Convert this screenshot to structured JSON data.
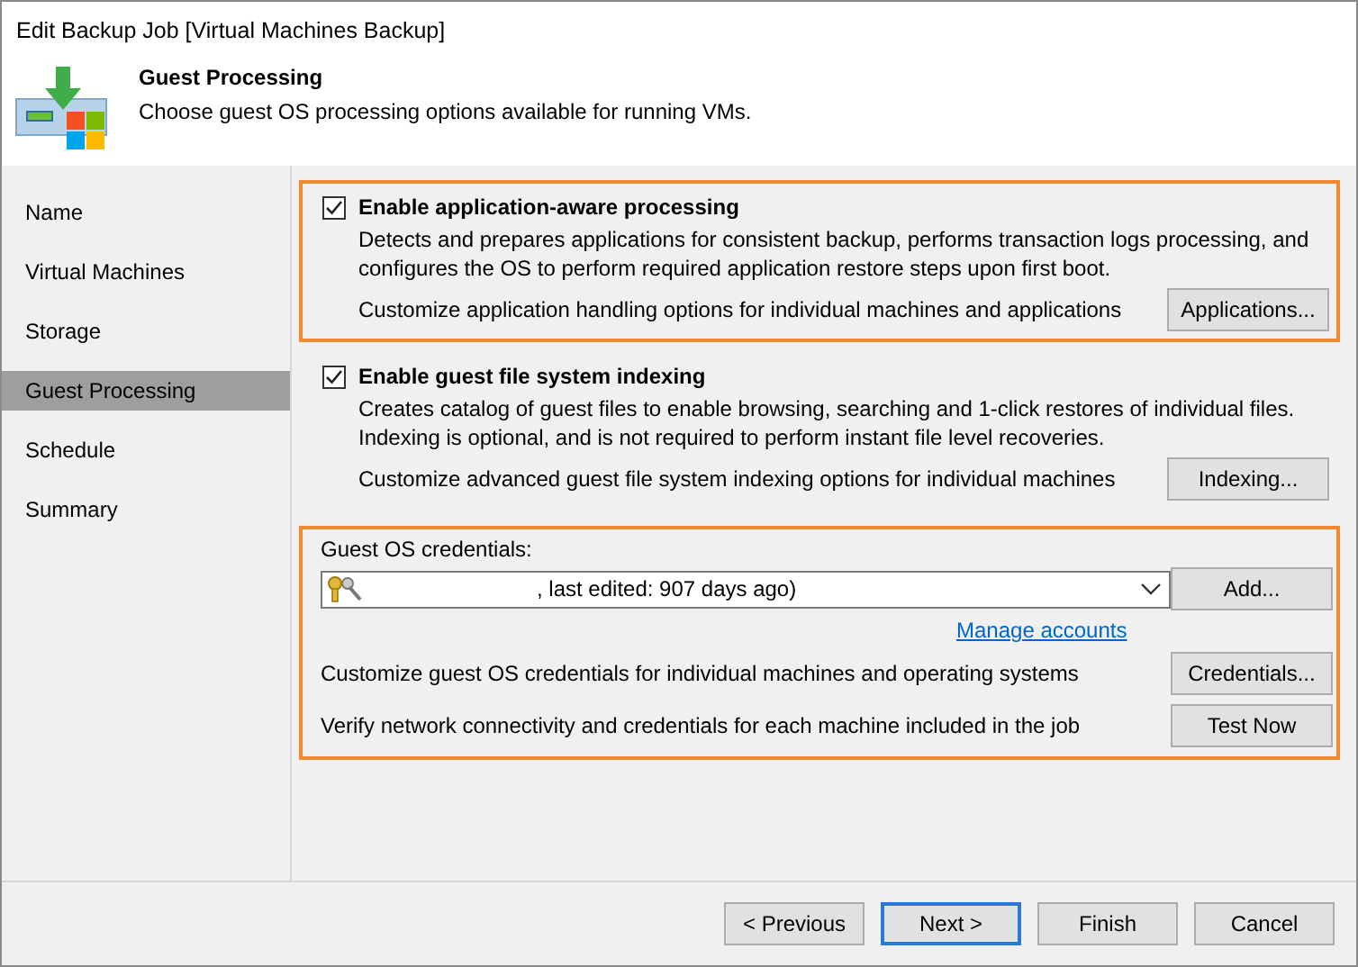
{
  "window": {
    "title": "Edit Backup Job [Virtual Machines Backup]"
  },
  "header": {
    "title": "Guest Processing",
    "subtitle": "Choose guest OS processing options available for running VMs."
  },
  "sidebar": {
    "items": [
      {
        "label": "Name",
        "selected": false
      },
      {
        "label": "Virtual Machines",
        "selected": false
      },
      {
        "label": "Storage",
        "selected": false
      },
      {
        "label": "Guest Processing",
        "selected": true
      },
      {
        "label": "Schedule",
        "selected": false
      },
      {
        "label": "Summary",
        "selected": false
      }
    ]
  },
  "sections": [
    {
      "title": "Enable application-aware processing",
      "checked": true,
      "highlighted": true,
      "description": "Detects and prepares applications for consistent backup, performs transaction logs processing, and configures the OS to perform required application restore steps upon first boot.",
      "option_text": "Customize application handling options for individual machines and applications",
      "button": "Applications..."
    },
    {
      "title": "Enable guest file system indexing",
      "checked": true,
      "highlighted": false,
      "description": "Creates catalog of guest files to enable browsing, searching and 1-click restores of individual files. Indexing is optional, and is not required to perform instant file level recoveries.",
      "option_text": "Customize advanced guest file system indexing options for individual machines",
      "button": "Indexing..."
    }
  ],
  "credentials": {
    "highlighted": true,
    "label": "Guest OS credentials:",
    "value": ", last edited: 907 days ago)",
    "add_button": "Add...",
    "link": "Manage accounts",
    "rows": [
      {
        "text": "Customize guest OS credentials for individual machines and operating systems",
        "button": "Credentials..."
      },
      {
        "text": "Verify network connectivity and credentials for each machine included in the job",
        "button": "Test Now"
      }
    ]
  },
  "footer": {
    "buttons": [
      {
        "label": "< Previous",
        "default": false
      },
      {
        "label": "Next >",
        "default": true
      },
      {
        "label": "Finish",
        "default": false
      },
      {
        "label": "Cancel",
        "default": false
      }
    ]
  }
}
